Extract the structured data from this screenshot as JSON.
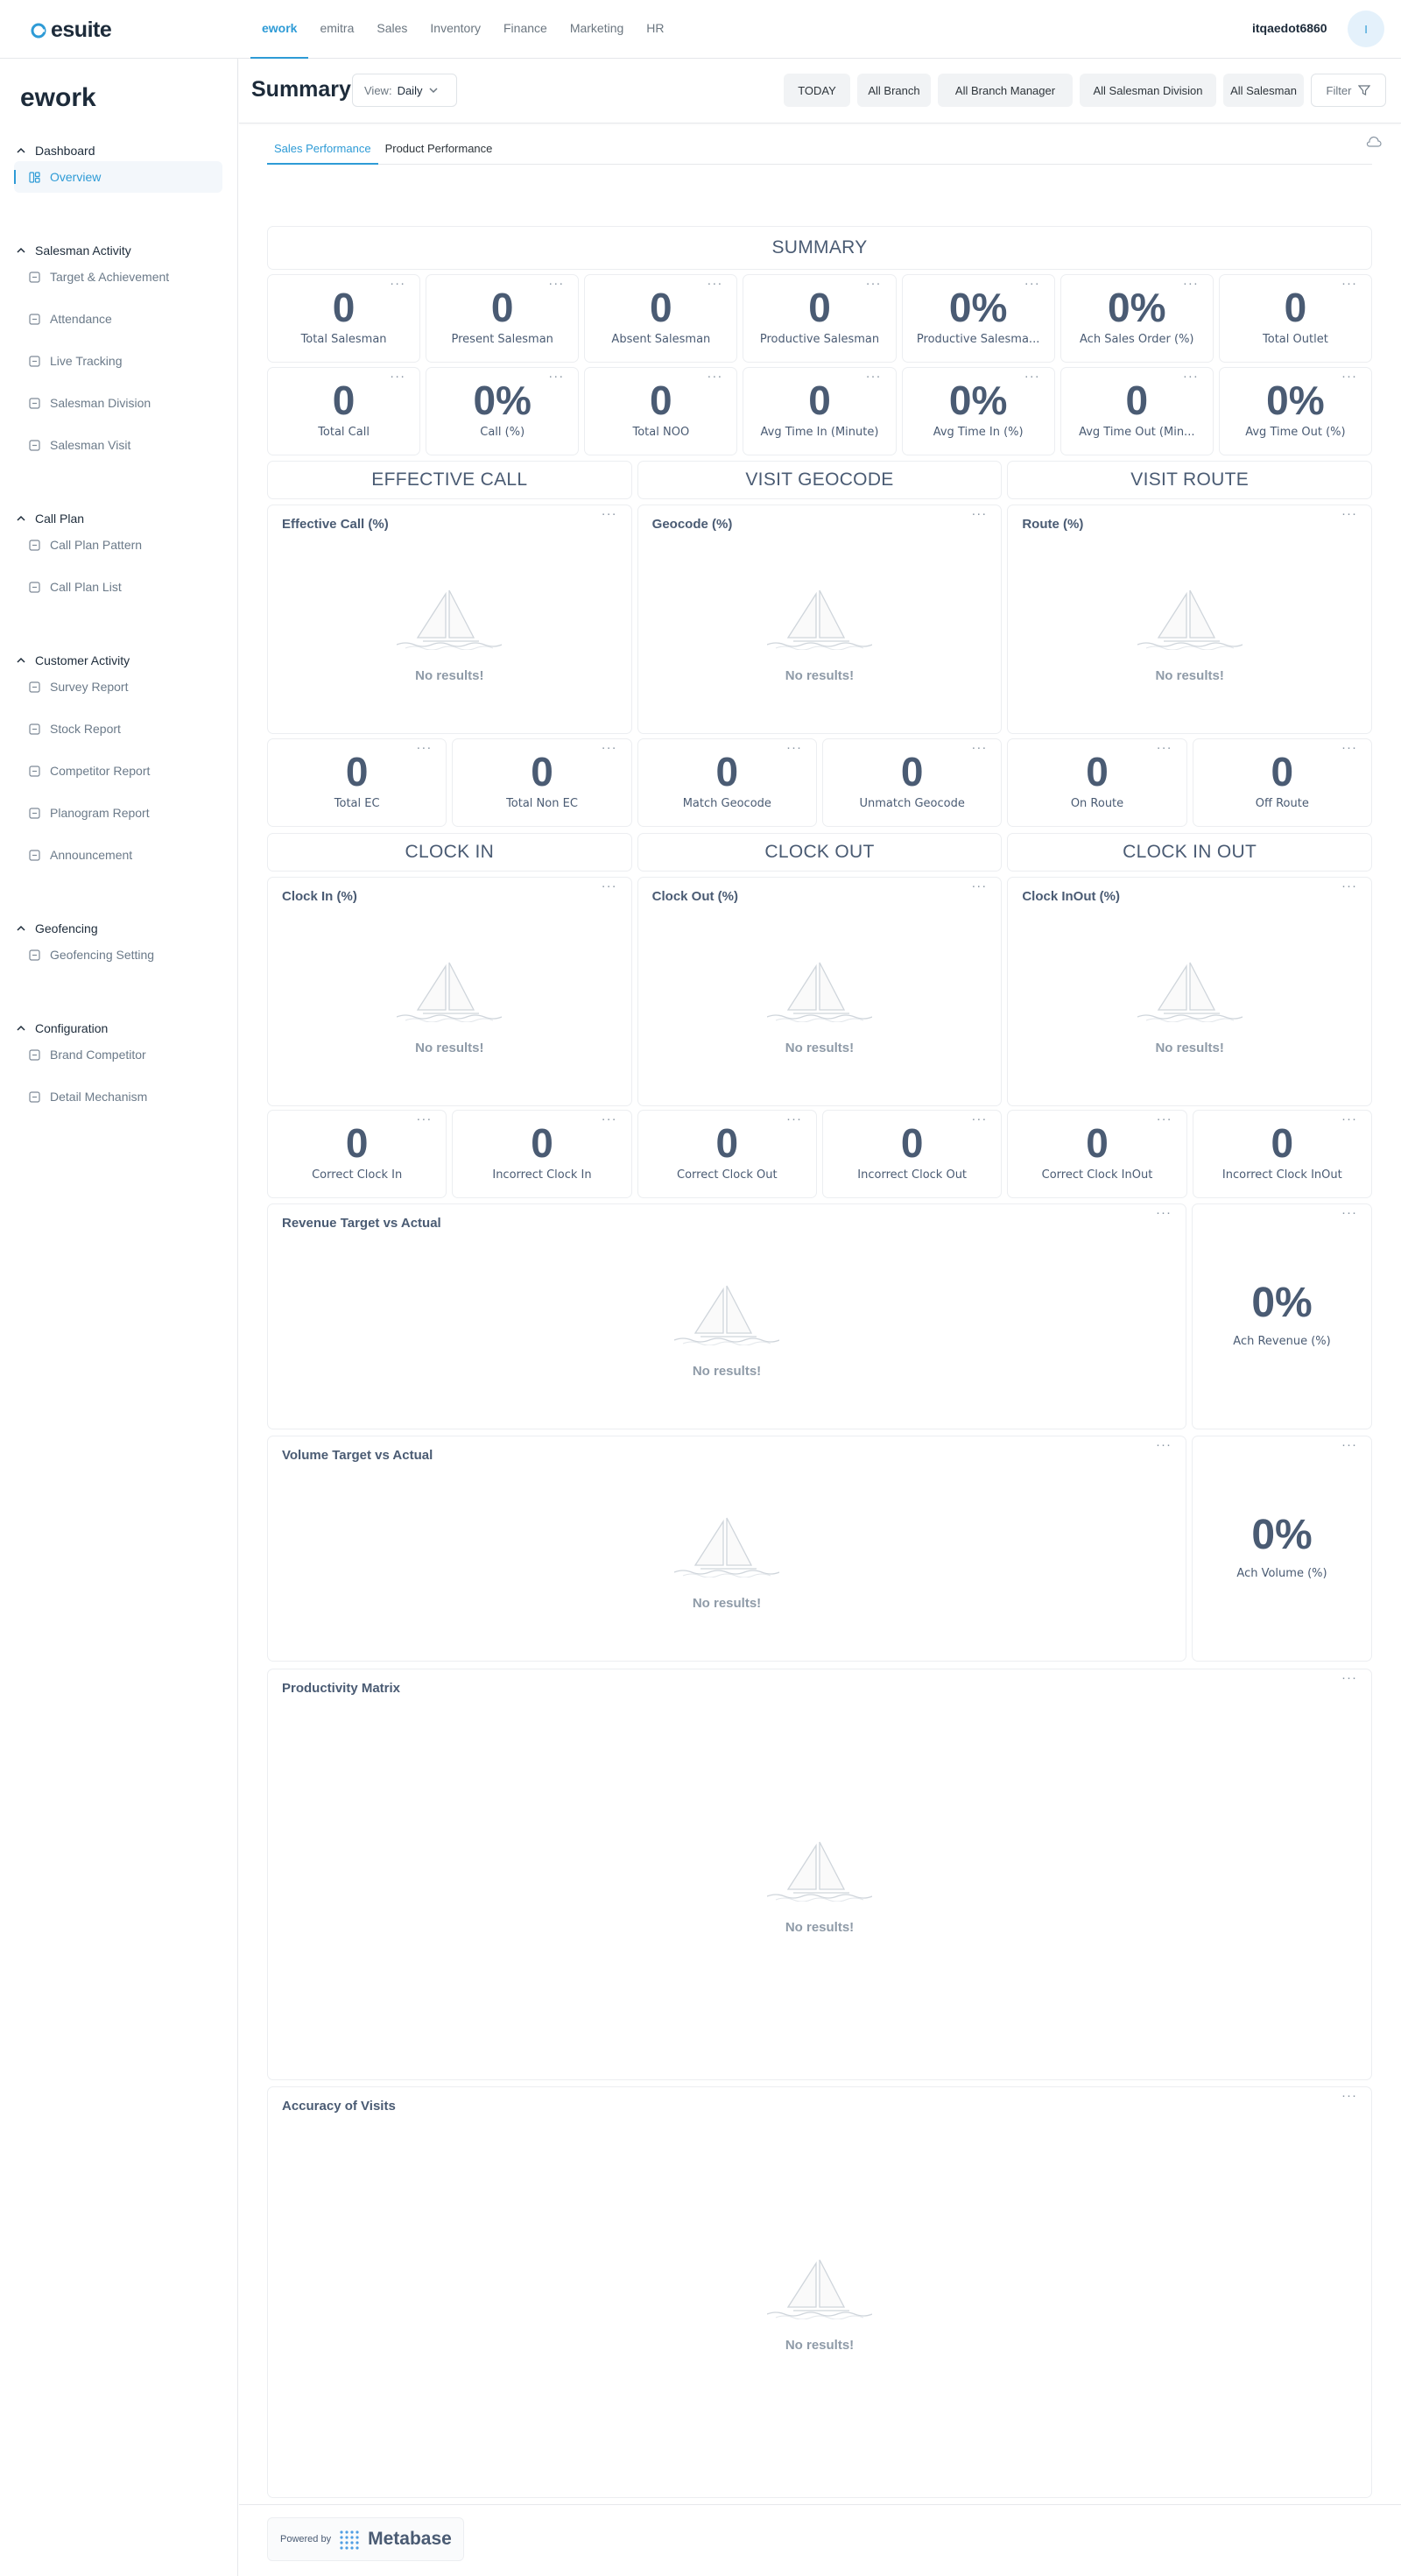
{
  "brand": {
    "name": "esuite"
  },
  "nav": {
    "items": [
      "ework",
      "emitra",
      "Sales",
      "Inventory",
      "Finance",
      "Marketing",
      "HR"
    ],
    "active": "ework"
  },
  "user": {
    "name": "itqaedot6860",
    "initial": "I"
  },
  "sidebar": {
    "title": "ework",
    "sections": [
      {
        "label": "Dashboard",
        "items": [
          {
            "label": "Overview",
            "icon": "layout-icon",
            "active": true
          }
        ]
      },
      {
        "label": "Salesman Activity",
        "items": [
          {
            "label": "Target & Achievement",
            "icon": "target-icon"
          },
          {
            "label": "Attendance",
            "icon": "users-icon"
          },
          {
            "label": "Live Tracking",
            "icon": "location-icon"
          },
          {
            "label": "Salesman Division",
            "icon": "chart-icon"
          },
          {
            "label": "Salesman Visit",
            "icon": "store-icon"
          }
        ]
      },
      {
        "label": "Call Plan",
        "items": [
          {
            "label": "Call Plan Pattern",
            "icon": "calendar-icon"
          },
          {
            "label": "Call Plan List",
            "icon": "calendar-icon"
          }
        ]
      },
      {
        "label": "Customer Activity",
        "items": [
          {
            "label": "Survey Report",
            "icon": "clipboard-icon"
          },
          {
            "label": "Stock Report",
            "icon": "box-icon"
          },
          {
            "label": "Competitor Report",
            "icon": "report-icon"
          },
          {
            "label": "Planogram Report",
            "icon": "report-icon"
          },
          {
            "label": "Announcement",
            "icon": "megaphone-icon"
          }
        ]
      },
      {
        "label": "Geofencing",
        "items": [
          {
            "label": "Geofencing Setting",
            "icon": "location-icon"
          }
        ]
      },
      {
        "label": "Configuration",
        "items": [
          {
            "label": "Brand Competitor",
            "icon": "tag-icon"
          },
          {
            "label": "Detail Mechanism",
            "icon": "list-icon"
          }
        ]
      }
    ]
  },
  "header": {
    "title": "Summary",
    "view_label": "View:",
    "view_value": "Daily",
    "filters": [
      "TODAY",
      "All Branch",
      "All Branch Manager",
      "All Salesman Division",
      "All Salesman"
    ],
    "filter_button": "Filter"
  },
  "tabs": [
    "Sales Performance",
    "Product Performance"
  ],
  "section_headers": {
    "summary": "SUMMARY",
    "effective_call": "EFFECTIVE CALL",
    "visit_geocode": "VISIT GEOCODE",
    "visit_route": "VISIT ROUTE",
    "clock_in": "CLOCK IN",
    "clock_out": "CLOCK OUT",
    "clock_in_out": "CLOCK IN OUT"
  },
  "summary_row1": [
    {
      "value": "0",
      "label": "Total Salesman"
    },
    {
      "value": "0",
      "label": "Present Salesman"
    },
    {
      "value": "0",
      "label": "Absent Salesman"
    },
    {
      "value": "0",
      "label": "Productive Salesman"
    },
    {
      "value": "0%",
      "label": "Productive Salesma..."
    },
    {
      "value": "0%",
      "label": "Ach Sales Order (%)"
    },
    {
      "value": "0",
      "label": "Total Outlet"
    }
  ],
  "summary_row2": [
    {
      "value": "0",
      "label": "Total Call"
    },
    {
      "value": "0%",
      "label": "Call (%)"
    },
    {
      "value": "0",
      "label": "Total NOO"
    },
    {
      "value": "0",
      "label": "Avg Time In (Minute)"
    },
    {
      "value": "0%",
      "label": "Avg Time In (%)"
    },
    {
      "value": "0",
      "label": "Avg Time Out (Min..."
    },
    {
      "value": "0%",
      "label": "Avg Time Out (%)"
    }
  ],
  "chart_row1": [
    {
      "title": "Effective Call (%)"
    },
    {
      "title": "Geocode (%)"
    },
    {
      "title": "Route (%)"
    }
  ],
  "visit_row": [
    {
      "value": "0",
      "label": "Total EC"
    },
    {
      "value": "0",
      "label": "Total Non EC"
    },
    {
      "value": "0",
      "label": "Match Geocode"
    },
    {
      "value": "0",
      "label": "Unmatch Geocode"
    },
    {
      "value": "0",
      "label": "On Route"
    },
    {
      "value": "0",
      "label": "Off Route"
    }
  ],
  "chart_row2": [
    {
      "title": "Clock In (%)"
    },
    {
      "title": "Clock Out (%)"
    },
    {
      "title": "Clock InOut (%)"
    }
  ],
  "clock_row": [
    {
      "value": "0",
      "label": "Correct Clock In"
    },
    {
      "value": "0",
      "label": "Incorrect Clock In"
    },
    {
      "value": "0",
      "label": "Correct Clock Out"
    },
    {
      "value": "0",
      "label": "Incorrect Clock Out"
    },
    {
      "value": "0",
      "label": "Correct Clock InOut"
    },
    {
      "value": "0",
      "label": "Incorrect Clock InOut"
    }
  ],
  "revenue": {
    "title": "Revenue Target vs Actual",
    "pct": "0%",
    "pct_label": "Ach Revenue (%)"
  },
  "volume": {
    "title": "Volume Target vs Actual",
    "pct": "0%",
    "pct_label": "Ach Volume (%)"
  },
  "productivity": {
    "title": "Productivity Matrix"
  },
  "accuracy": {
    "title": "Accuracy of Visits"
  },
  "empty_text": "No results!",
  "footer": {
    "powered_by": "Powered by",
    "product": "Metabase"
  },
  "colors": {
    "accent": "#2e9bd6",
    "text": "#4a5b73"
  }
}
